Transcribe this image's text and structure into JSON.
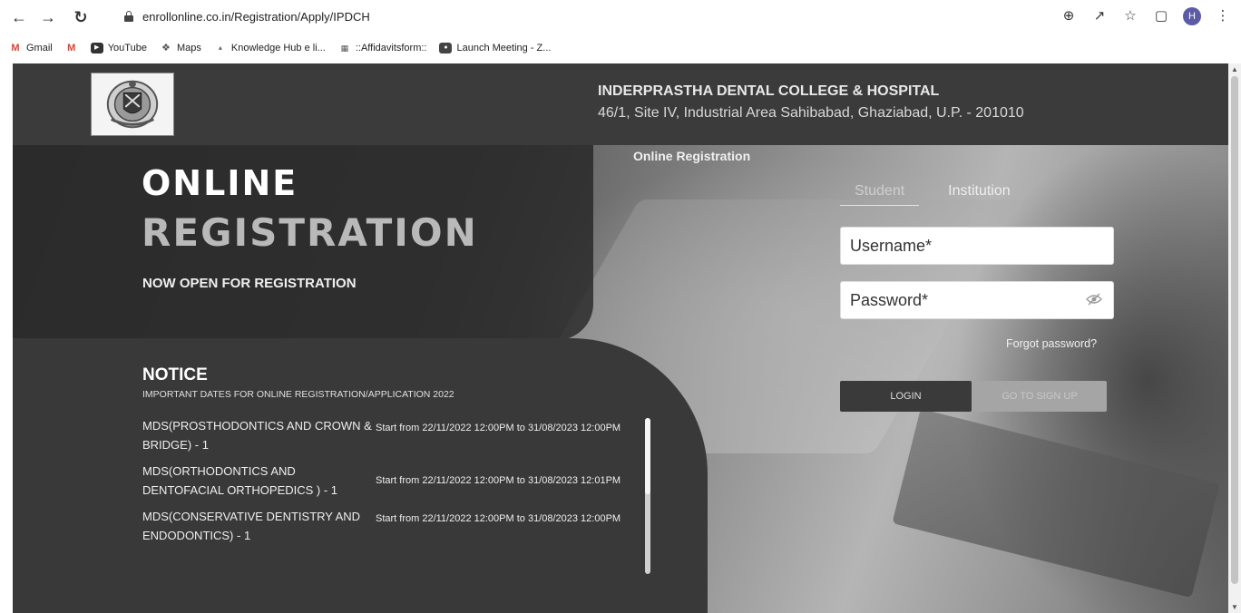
{
  "browser": {
    "url": "enrollonline.co.in/Registration/Apply/IPDCH",
    "avatar_letter": "H",
    "bookmarks": [
      {
        "label": "Gmail",
        "icon": "gmail-icon"
      },
      {
        "label": "",
        "icon": "gmail-m-icon"
      },
      {
        "label": "YouTube",
        "icon": "youtube-icon"
      },
      {
        "label": "Maps",
        "icon": "maps-icon"
      },
      {
        "label": "Knowledge Hub e li...",
        "icon": "knowledge-hub-icon"
      },
      {
        "label": "::Affidavitsform::",
        "icon": "affidavit-icon"
      },
      {
        "label": "Launch Meeting - Z...",
        "icon": "zoom-icon"
      }
    ]
  },
  "header": {
    "college_name": "INDERPRASTHA DENTAL COLLEGE & HOSPITAL",
    "college_address": "46/1, Site IV, Industrial Area Sahibabad, Ghaziabad, U.P. - 201010"
  },
  "hero": {
    "section_label": "Online Registration",
    "title_line1": "ONLINE",
    "title_line2": "REGISTRATION",
    "subtitle": "NOW OPEN FOR REGISTRATION"
  },
  "notice": {
    "title": "NOTICE",
    "subtitle": "IMPORTANT DATES FOR ONLINE REGISTRATION/APPLICATION 2022",
    "items": [
      {
        "course": "MDS(PROSTHODONTICS AND CROWN & BRIDGE) - 1",
        "dates": "Start from 22/11/2022 12:00PM to 31/08/2023 12:00PM"
      },
      {
        "course": "MDS(ORTHODONTICS AND DENTOFACIAL ORTHOPEDICS ) - 1",
        "dates": "Start from 22/11/2022 12:00PM to 31/08/2023 12:01PM"
      },
      {
        "course": "MDS(CONSERVATIVE DENTISTRY AND ENDODONTICS) - 1",
        "dates": "Start from 22/11/2022 12:00PM to 31/08/2023 12:00PM"
      }
    ]
  },
  "login": {
    "tab_student": "Student",
    "tab_institution": "Institution",
    "username_placeholder": "Username*",
    "password_placeholder": "Password*",
    "forgot": "Forgot password?",
    "login_label": "LOGIN",
    "signup_label": "GO TO SIGN UP"
  }
}
